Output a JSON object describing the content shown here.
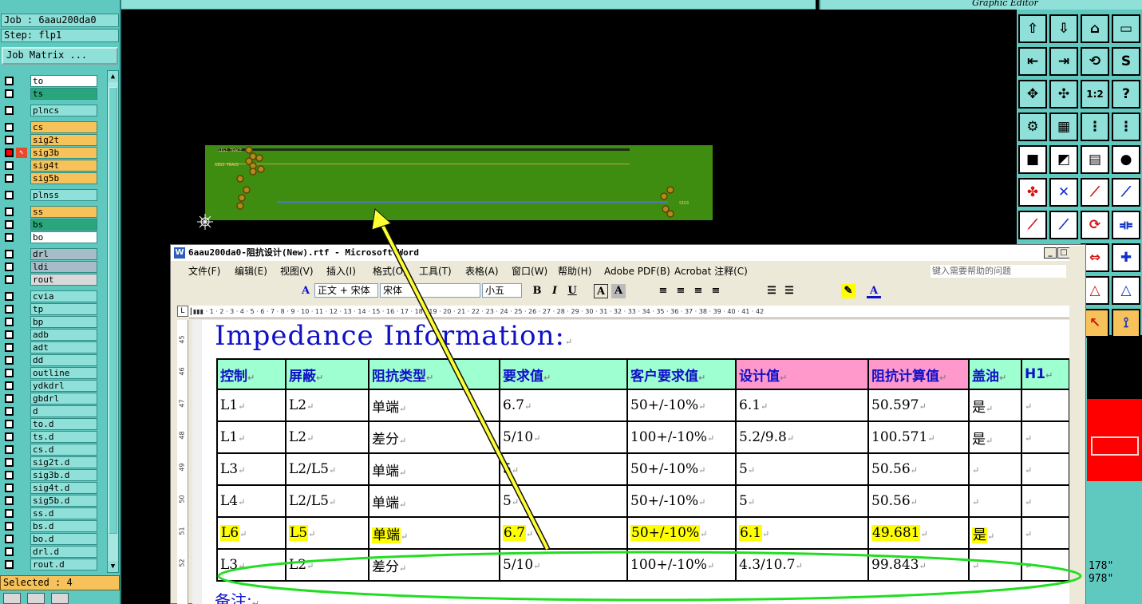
{
  "genesis": {
    "job_label": "Job : 6aau200da0",
    "step_label": "Step: flp1",
    "job_matrix_button": "Job Matrix ...",
    "editor_title": "Graphic Editor",
    "selected_label": "Selected : 4",
    "coord_line1": "178\"",
    "coord_line2": "978\"",
    "layers": [
      {
        "name": "to",
        "color": "#ffffff"
      },
      {
        "name": "ts",
        "color": "#2aa67c"
      },
      {
        "name": "plncs",
        "color": "#8fe0d8"
      },
      {
        "name": "cs",
        "color": "#f7c25a"
      },
      {
        "name": "sig2t",
        "color": "#f7c25a"
      },
      {
        "name": "sig3b",
        "color": "#f7c25a",
        "active": true
      },
      {
        "name": "sig4t",
        "color": "#f7c25a"
      },
      {
        "name": "sig5b",
        "color": "#f7c25a"
      },
      {
        "name": "plnss",
        "color": "#8fe0d8"
      },
      {
        "name": "ss",
        "color": "#f7c25a"
      },
      {
        "name": "bs",
        "color": "#2aa67c"
      },
      {
        "name": "bo",
        "color": "#ffffff"
      },
      {
        "name": "drl",
        "color": "#a6bcc7"
      },
      {
        "name": "ldi",
        "color": "#a6bcc7"
      },
      {
        "name": "rout",
        "color": "#d9d9d9"
      },
      {
        "name": "cvia",
        "color": "#8fe0d8"
      },
      {
        "name": "tp",
        "color": "#8fe0d8"
      },
      {
        "name": "bp",
        "color": "#8fe0d8"
      },
      {
        "name": "adb",
        "color": "#8fe0d8"
      },
      {
        "name": "adt",
        "color": "#8fe0d8"
      },
      {
        "name": "dd",
        "color": "#8fe0d8"
      },
      {
        "name": "outline",
        "color": "#8fe0d8"
      },
      {
        "name": "ydkdrl",
        "color": "#8fe0d8"
      },
      {
        "name": "gbdrl",
        "color": "#8fe0d8"
      },
      {
        "name": "d",
        "color": "#8fe0d8"
      },
      {
        "name": "to.d",
        "color": "#8fe0d8"
      },
      {
        "name": "ts.d",
        "color": "#8fe0d8"
      },
      {
        "name": "cs.d",
        "color": "#8fe0d8"
      },
      {
        "name": "sig2t.d",
        "color": "#8fe0d8"
      },
      {
        "name": "sig3b.d",
        "color": "#8fe0d8"
      },
      {
        "name": "sig4t.d",
        "color": "#8fe0d8"
      },
      {
        "name": "sig5b.d",
        "color": "#8fe0d8"
      },
      {
        "name": "ss.d",
        "color": "#8fe0d8"
      },
      {
        "name": "bs.d",
        "color": "#8fe0d8"
      },
      {
        "name": "bo.d",
        "color": "#8fe0d8"
      },
      {
        "name": "drl.d",
        "color": "#8fe0d8"
      },
      {
        "name": "rout.d",
        "color": "#8fe0d8"
      }
    ]
  },
  "word": {
    "window_title": "6aau200da0-阻抗设计(New).rtf - Microsoft Word",
    "menu": [
      "文件(F)",
      "编辑(E)",
      "视图(V)",
      "插入(I)",
      "格式(O)",
      "工具(T)",
      "表格(A)",
      "窗口(W)",
      "帮助(H)",
      "Adobe PDF(B)",
      "Acrobat 注释(C)"
    ],
    "help_placeholder": "键入需要帮助的问题",
    "style_value": "正文 + 宋体",
    "font_value": "宋体",
    "size_value": "小五",
    "heading": "Impedance Information:",
    "table": {
      "headers": [
        "控制",
        "屏蔽",
        "阻抗类型",
        "要求值",
        "客户要求值",
        "设计值",
        "阻抗计算值",
        "盖油",
        "H1"
      ],
      "rows": [
        [
          "L1",
          "L2",
          "单端",
          "6.7",
          "50+/-10%",
          "6.1",
          "50.597",
          "是",
          ""
        ],
        [
          "L1",
          "L2",
          "差分",
          "5/10",
          "100+/-10%",
          "5.2/9.8",
          "100.571",
          "是",
          ""
        ],
        [
          "L3",
          "L2/L5",
          "单端",
          "5",
          "50+/-10%",
          "5",
          "50.56",
          "",
          ""
        ],
        [
          "L4",
          "L2/L5",
          "单端",
          "5",
          "50+/-10%",
          "5",
          "50.56",
          "",
          ""
        ],
        [
          "L6",
          "L5",
          "单端",
          "6.7",
          "50+/-10%",
          "6.1",
          "49.681",
          "是",
          ""
        ],
        [
          "L3",
          "L2",
          "差分",
          "5/10",
          "100+/-10%",
          "4.3/10.7",
          "99.843",
          "",
          ""
        ]
      ],
      "highlight_row": 4
    },
    "notes_label": "备注:"
  },
  "colors": {
    "panel": "#5fc8bf",
    "pcb_green": "#3f8d10",
    "arrow_yellow": "#ffff33",
    "ellipse_green": "#22dd22",
    "word_header_green": "#9effd0",
    "word_header_pink": "#ff99cc",
    "highlight": "#ffff00"
  }
}
